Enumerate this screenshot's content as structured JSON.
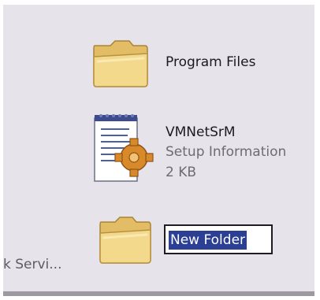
{
  "files": [
    {
      "name": "Program Files",
      "icon": "folder-icon"
    },
    {
      "name": "VMNetSrM",
      "type": "Setup Information",
      "size": "2 KB",
      "icon": "setup-information-file-icon"
    },
    {
      "name": "New Folder",
      "icon": "folder-icon",
      "renaming": true
    }
  ],
  "partial_item_label": "k Servi..."
}
